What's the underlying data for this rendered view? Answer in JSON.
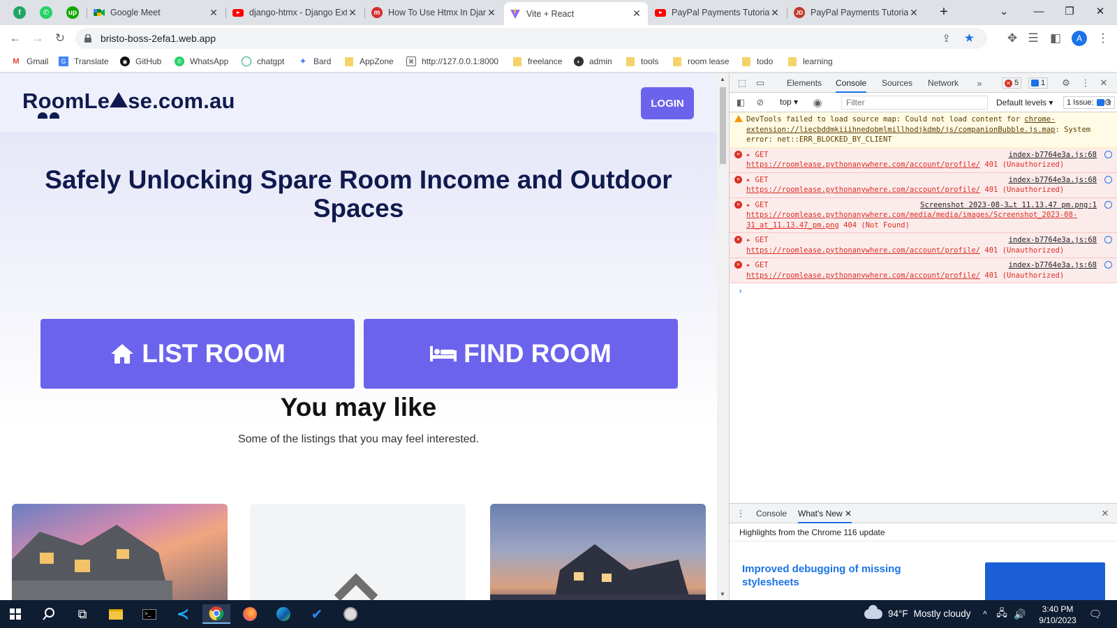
{
  "browser": {
    "tabs": [
      {
        "title": "Google Meet"
      },
      {
        "title": "django-htmx - Django Ext"
      },
      {
        "title": "How To Use Htmx In Djan"
      },
      {
        "title": "Vite + React"
      },
      {
        "title": "PayPal Payments Tutorial"
      },
      {
        "title": "PayPal Payments Tutorial"
      }
    ],
    "active_tab_index": 3,
    "url": "bristo-boss-2efa1.web.app",
    "profile_initial": "A",
    "bookmarks": [
      "Gmail",
      "Translate",
      "GitHub",
      "WhatsApp",
      "chatgpt",
      "Bard",
      "AppZone",
      "http://127.0.0.1:8000",
      "freelance",
      "admin",
      "tools",
      "room lease",
      "todo",
      "learning"
    ]
  },
  "site": {
    "logo": "RoomLe se.com.au",
    "logo_part1": "RoomLe",
    "logo_part2": "se.com.au",
    "login_label": "LOGIN",
    "hero_title": "Safely Unlocking Spare Room Income and Outdoor Spaces",
    "list_room_label": "LIST ROOM",
    "find_room_label": "FIND ROOM",
    "section_title": "You may like",
    "section_subtitle": "Some of the listings that you may feel interested.",
    "accent_color": "#6c63ed",
    "navy_color": "#101a4e"
  },
  "devtools": {
    "tabs": [
      "Elements",
      "Console",
      "Sources",
      "Network"
    ],
    "active_tab": "Console",
    "error_count": "5",
    "message_count": "1",
    "context": "top",
    "filter_placeholder": "Filter",
    "levels": "Default levels",
    "issues": "1 Issue:",
    "issues_count": "1",
    "messages": [
      {
        "level": "warning",
        "text_before": "DevTools failed to load source map: Could not load content for ",
        "link": "chrome-extension://liecbddmkiiihnedobmlmillhodjkdmb/js/companionBubble.js.map",
        "text_after": ": System error: net::ERR_BLOCKED_BY_CLIENT"
      },
      {
        "level": "error",
        "method": "GET",
        "url": "https://roomlease.pythonanywhere.com/account/profile/",
        "status": "401 (Unauthorized)",
        "source": "index-b7764e3a.js:68"
      },
      {
        "level": "error",
        "method": "GET",
        "url": "https://roomlease.pythonanywhere.com/account/profile/",
        "status": "401 (Unauthorized)",
        "source": "index-b7764e3a.js:68"
      },
      {
        "level": "error",
        "method": "GET",
        "url": "https://roomlease.pythonanywhere.com/media/media/images/Screenshot_2023-08-31_at_11.13.47_pm.png",
        "status": "404 (Not Found)",
        "source": "Screenshot 2023-08-3…t 11.13.47 pm.png:1"
      },
      {
        "level": "error",
        "method": "GET",
        "url": "https://roomlease.pythonanywhere.com/account/profile/",
        "status": "401 (Unauthorized)",
        "source": "index-b7764e3a.js:68"
      },
      {
        "level": "error",
        "method": "GET",
        "url": "https://roomlease.pythonanywhere.com/account/profile/",
        "status": "401 (Unauthorized)",
        "source": "index-b7764e3a.js:68"
      }
    ],
    "drawer_tabs": [
      "Console",
      "What's New"
    ],
    "whats_new_heading": "Highlights from the Chrome 116 update",
    "whats_new_link": "Improved debugging of missing stylesheets"
  },
  "taskbar": {
    "weather_temp": "94°F",
    "weather_text": "Mostly cloudy",
    "time": "3:40 PM",
    "date": "9/10/2023"
  }
}
